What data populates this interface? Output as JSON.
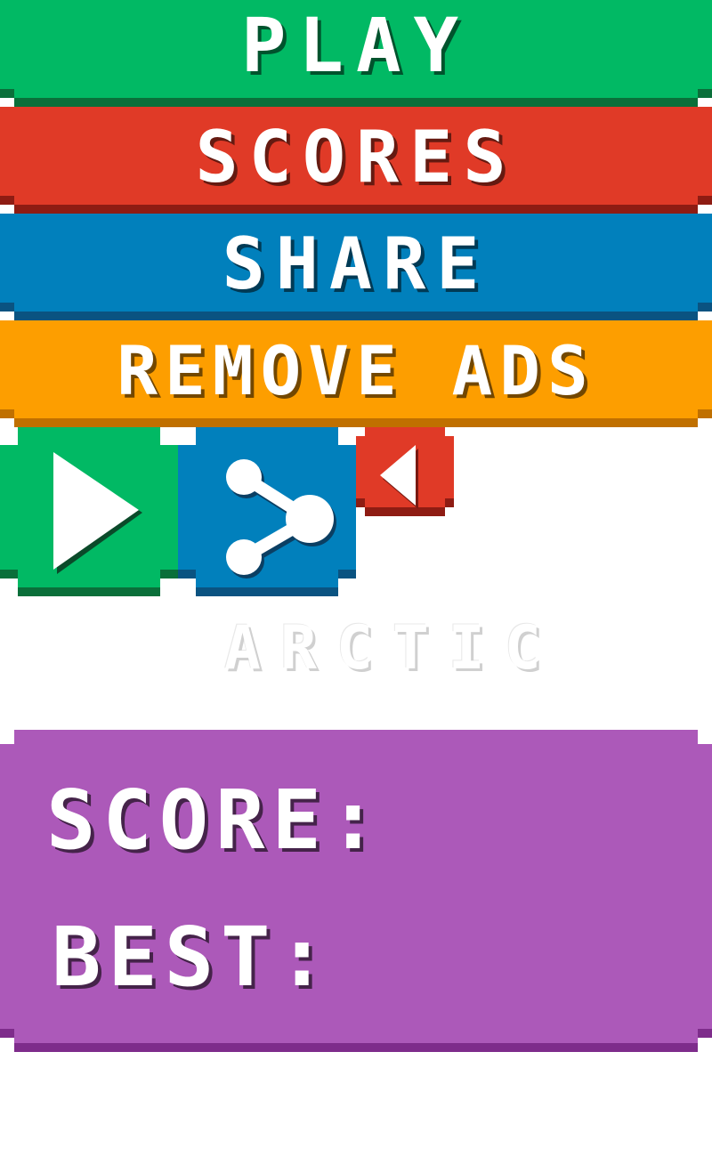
{
  "menu": {
    "play_label": "PLAY",
    "scores_label": "SCORES",
    "share_label": "SHARE",
    "remove_ads_label": "REMOVE ADS"
  },
  "icons": {
    "play": "play-icon",
    "share": "share-icon",
    "back": "back-icon"
  },
  "faint_label": "ARCTIC",
  "panel": {
    "score_label": "SCORE:",
    "best_label": "BEST:"
  },
  "colors": {
    "green": "#01b964",
    "green_dark": "#0a6f3a",
    "red": "#e03a27",
    "red_dark": "#8e1c13",
    "blue": "#0180bc",
    "blue_dark": "#0a5381",
    "orange": "#fd9e00",
    "orange_dark": "#c07000",
    "purple": "#ac59b9",
    "purple_dark": "#7e2c8b"
  }
}
